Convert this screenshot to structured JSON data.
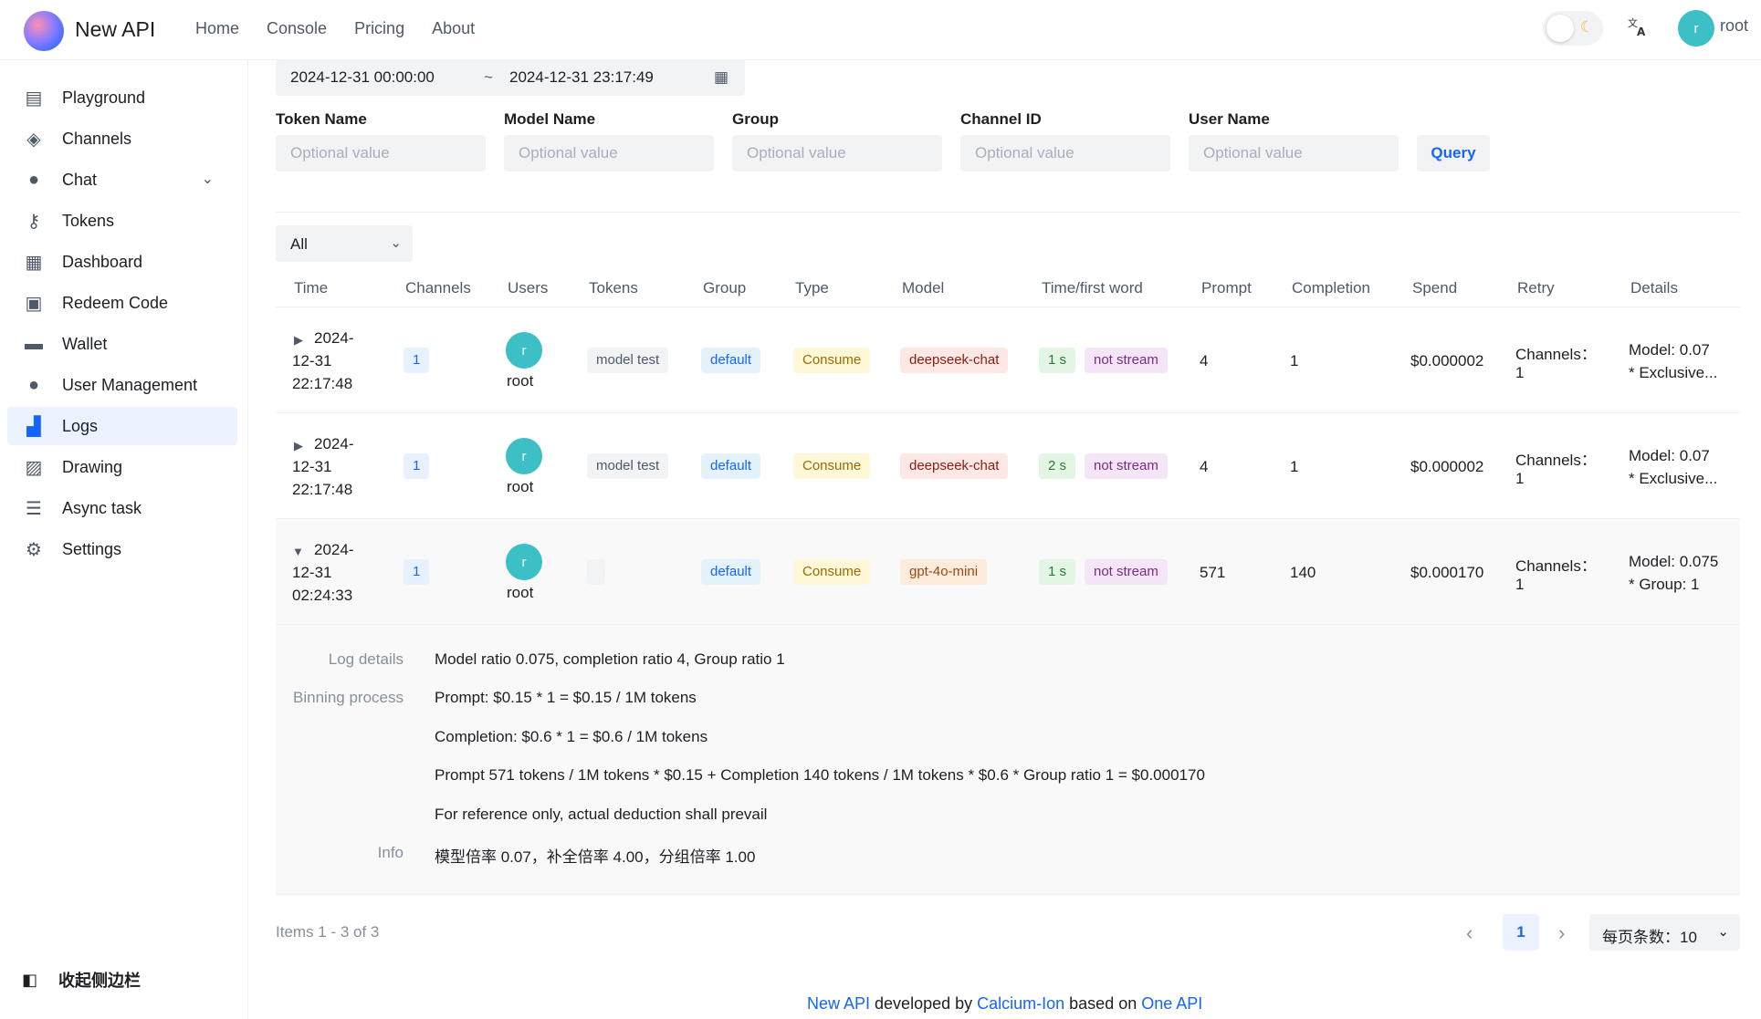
{
  "header": {
    "brand": "New API",
    "nav": [
      "Home",
      "Console",
      "Pricing",
      "About"
    ],
    "avatar_letter": "r",
    "user": "root",
    "theme_icon": "moon-icon",
    "translate_icon": "translate-icon"
  },
  "sidebar": {
    "items": [
      {
        "label": "Playground",
        "icon": "playground-icon"
      },
      {
        "label": "Channels",
        "icon": "layers-icon"
      },
      {
        "label": "Chat",
        "icon": "chat-bubble-icon"
      },
      {
        "label": "Tokens",
        "icon": "key-icon"
      },
      {
        "label": "Dashboard",
        "icon": "calendar-clock-icon"
      },
      {
        "label": "Redeem Code",
        "icon": "gift-icon"
      },
      {
        "label": "Wallet",
        "icon": "credit-card-icon"
      },
      {
        "label": "User Management",
        "icon": "user-icon"
      },
      {
        "label": "Logs",
        "icon": "bar-chart-icon"
      },
      {
        "label": "Drawing",
        "icon": "image-icon"
      },
      {
        "label": "Async task",
        "icon": "task-list-icon"
      },
      {
        "label": "Settings",
        "icon": "gear-icon"
      }
    ],
    "active": "Logs",
    "collapse_label": "收起侧边栏"
  },
  "filters": {
    "date_start": "2024-12-31 00:00:00",
    "date_sep": "~",
    "date_end": "2024-12-31 23:17:49",
    "fields": [
      {
        "label": "Token Name",
        "placeholder": "Optional value"
      },
      {
        "label": "Model Name",
        "placeholder": "Optional value"
      },
      {
        "label": "Group",
        "placeholder": "Optional value"
      },
      {
        "label": "Channel ID",
        "placeholder": "Optional value"
      },
      {
        "label": "User Name",
        "placeholder": "Optional value"
      }
    ],
    "query_label": "Query",
    "type_select": "All"
  },
  "table": {
    "columns": [
      "Time",
      "Channels",
      "Users",
      "Tokens",
      "Group",
      "Type",
      "Model",
      "Time/first word",
      "Prompt",
      "Completion",
      "Spend",
      "Retry",
      "Details"
    ],
    "rows": [
      {
        "time_l1": "2024-",
        "time_l2": "12-31",
        "time_l3": "22:17:48",
        "channel": "1",
        "user_avatar": "r",
        "user": "root",
        "token": "model test",
        "group": "default",
        "type": "Consume",
        "model": "deepseek-chat",
        "first_word": "1 s",
        "stream": "not stream",
        "prompt": "4",
        "completion": "1",
        "spend": "$0.000002",
        "retry_l1": "Channels：",
        "retry_l2": "1",
        "details_l1": "Model: 0.07",
        "details_l2": "* Exclusive..."
      },
      {
        "time_l1": "2024-",
        "time_l2": "12-31",
        "time_l3": "22:17:48",
        "channel": "1",
        "user_avatar": "r",
        "user": "root",
        "token": "model test",
        "group": "default",
        "type": "Consume",
        "model": "deepseek-chat",
        "first_word": "2 s",
        "stream": "not stream",
        "prompt": "4",
        "completion": "1",
        "spend": "$0.000002",
        "retry_l1": "Channels：",
        "retry_l2": "1",
        "details_l1": "Model: 0.07",
        "details_l2": "* Exclusive..."
      },
      {
        "time_l1": "2024-",
        "time_l2": "12-31",
        "time_l3": "02:24:33",
        "channel": "1",
        "user_avatar": "r",
        "user": "root",
        "token": "",
        "group": "default",
        "type": "Consume",
        "model": "gpt-4o-mini",
        "first_word": "1 s",
        "stream": "not stream",
        "prompt": "571",
        "completion": "140",
        "spend": "$0.000170",
        "retry_l1": "Channels：",
        "retry_l2": "1",
        "details_l1": "Model: 0.075",
        "details_l2": "* Group: 1"
      }
    ]
  },
  "details": {
    "log_details_key": "Log details",
    "log_details_val": "Model ratio 0.075, completion ratio 4, Group ratio 1",
    "billing_key": "Binning process",
    "billing_lines": [
      "Prompt: $0.15 * 1 = $0.15 / 1M tokens",
      "Completion: $0.6 * 1 = $0.6 / 1M tokens",
      "Prompt 571 tokens / 1M tokens * $0.15 + Completion 140 tokens / 1M tokens * $0.6 * Group ratio 1 = $0.000170",
      "For reference only, actual deduction shall prevail"
    ],
    "info_key": "Info",
    "info_val": "模型倍率 0.07，补全倍率 4.00，分组倍率 1.00"
  },
  "pagination": {
    "items": "Items 1 - 3 of 3",
    "current": "1",
    "page_size": "每页条数：10"
  },
  "footer": {
    "link1": "New API",
    "text1": " developed by ",
    "link2": "Calcium-Ion",
    "text2": " based on ",
    "link3": "One API"
  }
}
